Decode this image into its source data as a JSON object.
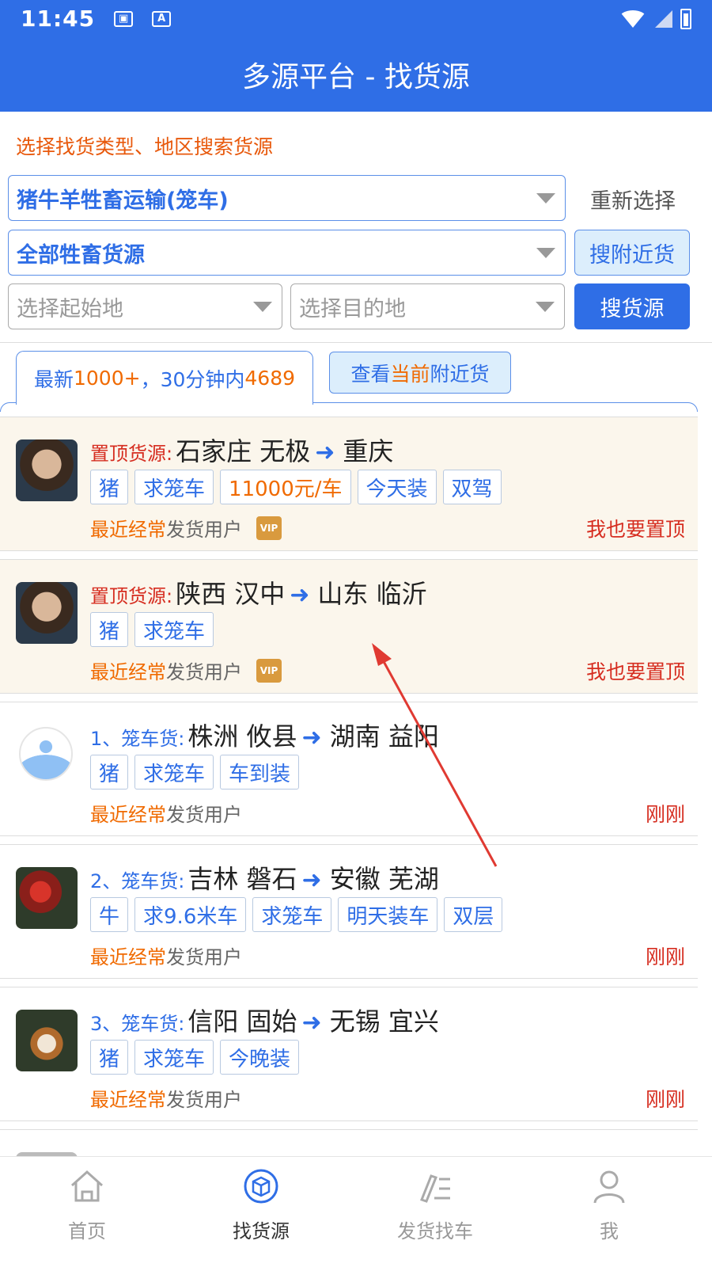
{
  "status": {
    "time": "11:45",
    "a_icon": "A"
  },
  "header": {
    "title": "多源平台 - 找货源"
  },
  "search": {
    "hint": "选择找货类型、地区搜索货源",
    "type_select": "猪牛羊牲畜运输(笼车)",
    "source_select": "全部牲畜货源",
    "origin_placeholder": "选择起始地",
    "destination_placeholder": "选择目的地",
    "reset_label": "重新选择",
    "nearby_label": "搜附近货",
    "search_label": "搜货源"
  },
  "tabs": {
    "latest_prefix": "最新",
    "latest_count": "1000+",
    "latest_mid": "，30分钟内",
    "latest_recent": "4689",
    "nearby_pre": "查看",
    "nearby_hl": "当前",
    "nearby_post": "附近货"
  },
  "listings": [
    {
      "prefix": "置顶货源:",
      "from": "石家庄 无极",
      "to": "重庆",
      "tags": [
        "猪",
        "求笼车",
        "11000元/车",
        "今天装",
        "双驾"
      ],
      "meta_hl": "最近经常",
      "meta": "发货用户",
      "vip": "VIP",
      "action": "我也要置顶"
    },
    {
      "prefix": "置顶货源:",
      "from": "陕西 汉中",
      "to": "山东 临沂",
      "tags": [
        "猪",
        "求笼车"
      ],
      "meta_hl": "最近经常",
      "meta": "发货用户",
      "vip": "VIP",
      "action": "我也要置顶"
    },
    {
      "prefix": "1、笼车货:",
      "from": "株洲 攸县",
      "to": "湖南 益阳",
      "tags": [
        "猪",
        "求笼车",
        "车到装"
      ],
      "meta_hl": "最近经常",
      "meta": "发货用户",
      "time": "刚刚"
    },
    {
      "prefix": "2、笼车货:",
      "from": "吉林 磐石",
      "to": "安徽 芜湖",
      "tags": [
        "牛",
        "求9.6米车",
        "求笼车",
        "明天装车",
        "双层"
      ],
      "meta_hl": "最近经常",
      "meta": "发货用户",
      "time": "刚刚"
    },
    {
      "prefix": "3、笼车货:",
      "from": "信阳 固始",
      "to": "无锡 宜兴",
      "tags": [
        "猪",
        "求笼车",
        "今晚装"
      ],
      "meta_hl": "最近经常",
      "meta": "发货用户",
      "time": "刚刚"
    }
  ],
  "nav": {
    "home": "首页",
    "find": "找货源",
    "ship": "发货找车",
    "me": "我"
  },
  "colors": {
    "primary": "#2f6ee6",
    "orange": "#f06a00",
    "red": "#d62d20",
    "pinned_bg": "#fbf6ec"
  }
}
